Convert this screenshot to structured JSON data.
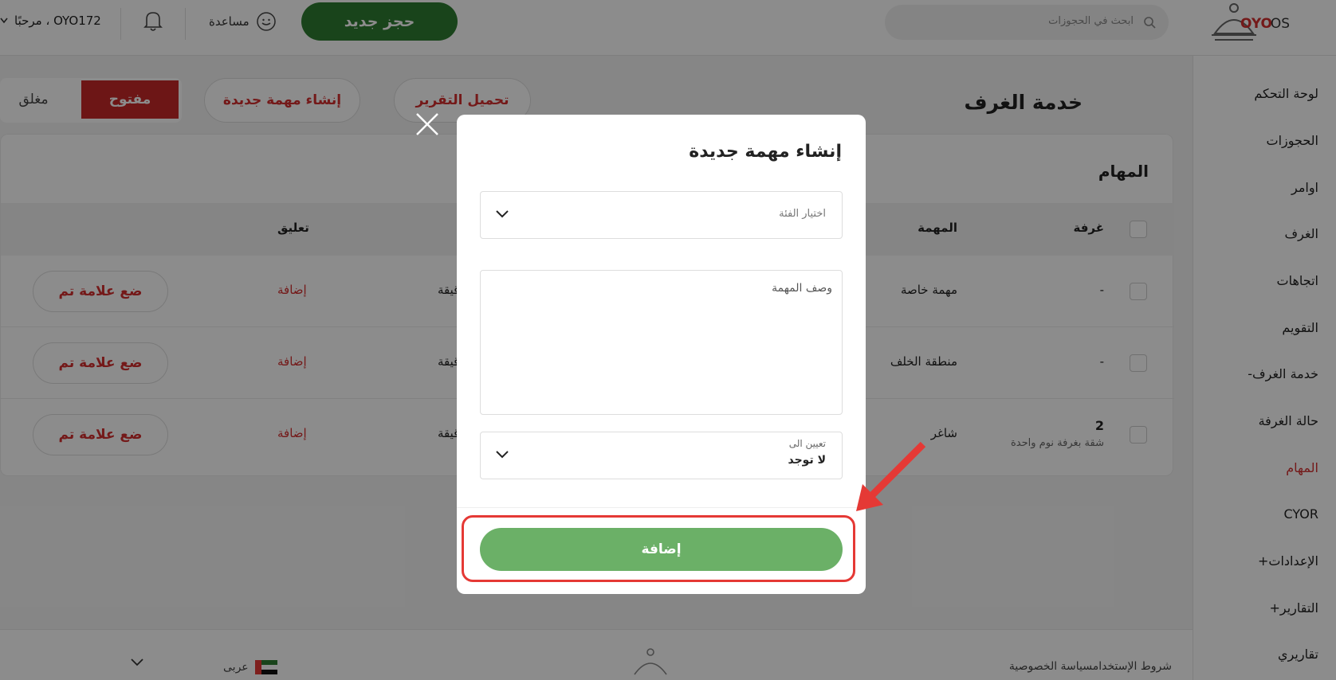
{
  "header": {
    "logo_oyo": "OYO",
    "logo_os": "OS",
    "search_placeholder": "ابحث في الحجوزات",
    "new_booking": "حجز جديد",
    "help": "مساعدة",
    "greeting": "مرحبًا ، OYO172"
  },
  "sidebar": {
    "items": [
      {
        "label": "لوحة التحكم"
      },
      {
        "label": "الحجوزات"
      },
      {
        "label": "اوامر"
      },
      {
        "label": "الغرف"
      },
      {
        "label": "اتجاهات"
      },
      {
        "label": "التقويم"
      },
      {
        "label": "خدمة الغرف-"
      },
      {
        "label": "حالة الغرفة"
      },
      {
        "label": "المهام",
        "active": true
      },
      {
        "label": "CYOR"
      },
      {
        "label": "الإعدادات+"
      },
      {
        "label": "التقارير+"
      },
      {
        "label": "تقاريري"
      }
    ]
  },
  "main": {
    "title": "خدمة الغرف",
    "download_report": "تحميل التقرير",
    "create_task": "إنشاء مهمة جديدة",
    "status_open": "مفتوح",
    "status_closed": "مغلق",
    "tasks_heading": "المهام",
    "columns": {
      "room": "غرفة",
      "task": "المهمة",
      "comment": "تعليق"
    },
    "rows": [
      {
        "room": "-",
        "room_sub": "",
        "task": "مهمة خاصة",
        "duration": "دقيقة",
        "comment": "إضافة",
        "action": "ضع علامة تم"
      },
      {
        "room": "-",
        "room_sub": "",
        "task": "منطقة الخلف",
        "duration": "دقيقة",
        "comment": "إضافة",
        "action": "ضع علامة تم"
      },
      {
        "room": "2",
        "room_sub": "شقة بغرفة نوم واحدة",
        "task": "شاغر",
        "duration": "دقيقة",
        "comment": "إضافة",
        "action": "ضع علامة تم"
      }
    ]
  },
  "footer": {
    "links": "شروط الإستخدامسياسة الخصوصية",
    "language": "عربى"
  },
  "modal": {
    "title": "إنشاء مهمة جديدة",
    "category_placeholder": "اختيار الفئة",
    "description_placeholder": "وصف المهمة",
    "assign_label": "تعيين الى",
    "assign_value": "لا توجد",
    "add_button": "إضافة"
  },
  "colors": {
    "brand_red": "#d32f2f",
    "primary_green": "#2e7d32",
    "add_green": "#6bb067",
    "annotation_red": "#e53935"
  }
}
